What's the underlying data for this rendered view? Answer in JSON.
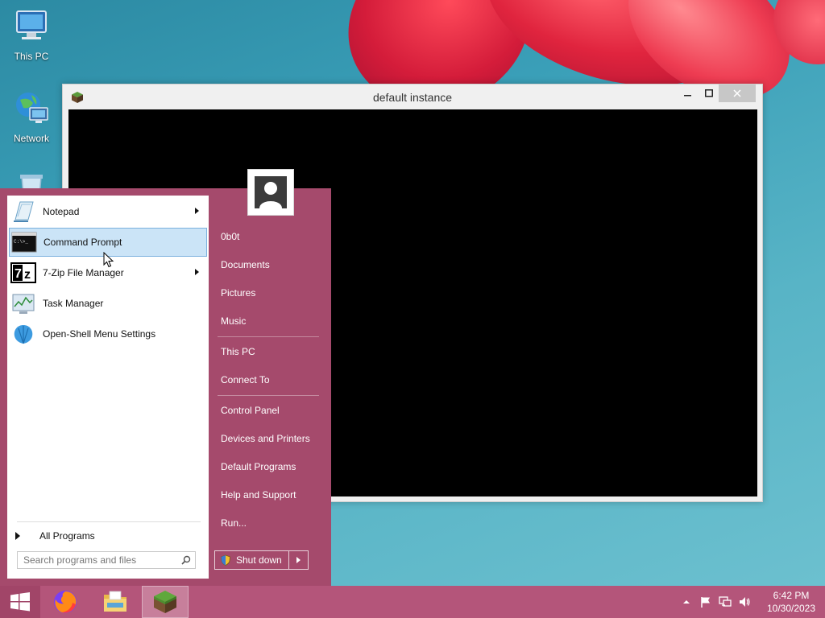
{
  "desktop": {
    "icons": [
      {
        "label": "This PC",
        "icon": "this-pc-icon"
      },
      {
        "label": "Network",
        "icon": "network-icon"
      },
      {
        "label": "",
        "icon": "recycle-bin-icon"
      }
    ]
  },
  "window": {
    "title": "default instance",
    "icon": "minecraft-block-icon",
    "controls": {
      "minimize": "minimize-icon",
      "maximize": "maximize-icon",
      "close": "close-icon"
    }
  },
  "start_menu": {
    "programs": [
      {
        "label": "Notepad",
        "icon": "notepad-icon",
        "has_submenu": true
      },
      {
        "label": "Command Prompt",
        "icon": "command-prompt-icon",
        "has_submenu": false,
        "highlighted": true
      },
      {
        "label": "7-Zip File Manager",
        "icon": "7zip-icon",
        "has_submenu": true
      },
      {
        "label": "Task Manager",
        "icon": "task-manager-icon",
        "has_submenu": false
      },
      {
        "label": "Open-Shell Menu Settings",
        "icon": "open-shell-icon",
        "has_submenu": false
      }
    ],
    "all_programs": "All Programs",
    "search": {
      "placeholder": "Search programs and files",
      "value": ""
    },
    "right_items": [
      {
        "label": "0b0t"
      },
      {
        "label": "Documents"
      },
      {
        "label": "Pictures"
      },
      {
        "label": "Music"
      },
      {
        "label": "This PC"
      },
      {
        "label": "Connect To"
      },
      {
        "label": "Control Panel"
      },
      {
        "label": "Devices and Printers"
      },
      {
        "label": "Default Programs"
      },
      {
        "label": "Help and Support"
      },
      {
        "label": "Run..."
      }
    ],
    "shutdown": {
      "label": "Shut down"
    }
  },
  "taskbar": {
    "apps": [
      {
        "name": "Firefox",
        "icon": "firefox-icon"
      },
      {
        "name": "File Explorer",
        "icon": "file-explorer-icon"
      },
      {
        "name": "Minecraft",
        "icon": "minecraft-icon",
        "active": true
      }
    ],
    "tray": {
      "time": "6:42 PM",
      "date": "10/30/2023"
    }
  },
  "colors": {
    "accent": "#a54a6c",
    "taskbar": "#b4557a",
    "highlight": "#cbe4f7"
  }
}
